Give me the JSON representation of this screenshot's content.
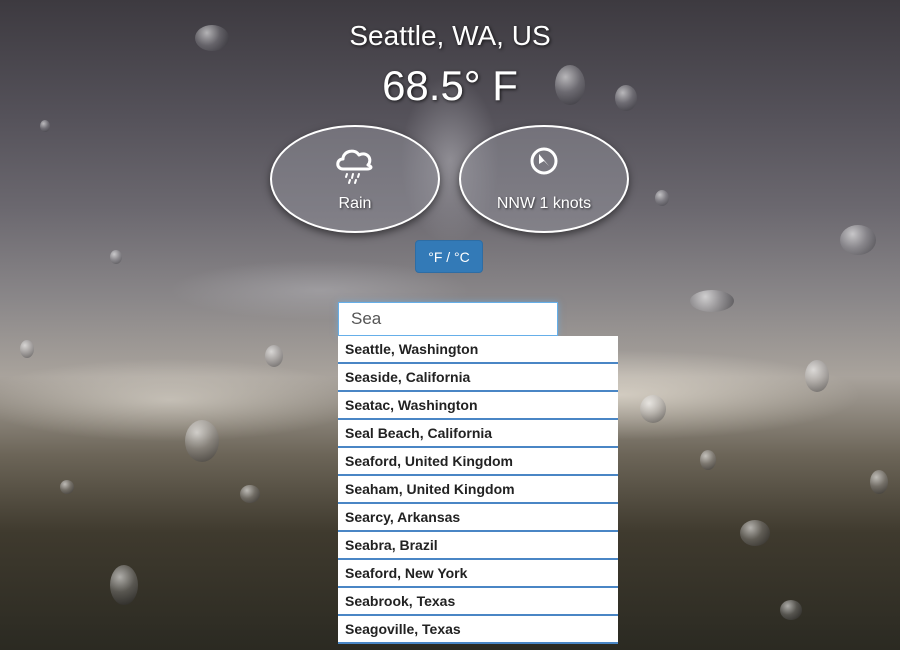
{
  "location": "Seattle, WA, US",
  "temperature": "68.5° F",
  "condition": {
    "label": "Rain",
    "icon": "rain-cloud-icon"
  },
  "wind": {
    "label": "NNW 1 knots",
    "icon": "wind-direction-icon"
  },
  "unit_toggle_label": "°F / °C",
  "search": {
    "value": "Sea"
  },
  "suggestions": [
    "Seattle, Washington",
    "Seaside, California",
    "Seatac, Washington",
    "Seal Beach, California",
    "Seaford, United Kingdom",
    "Seaham, United Kingdom",
    "Searcy, Arkansas",
    "Seabra, Brazil",
    "Seaford, New York",
    "Seabrook, Texas",
    "Seagoville, Texas"
  ],
  "colors": {
    "accent": "#337ab7",
    "suggestion_border": "#4a86c5"
  }
}
